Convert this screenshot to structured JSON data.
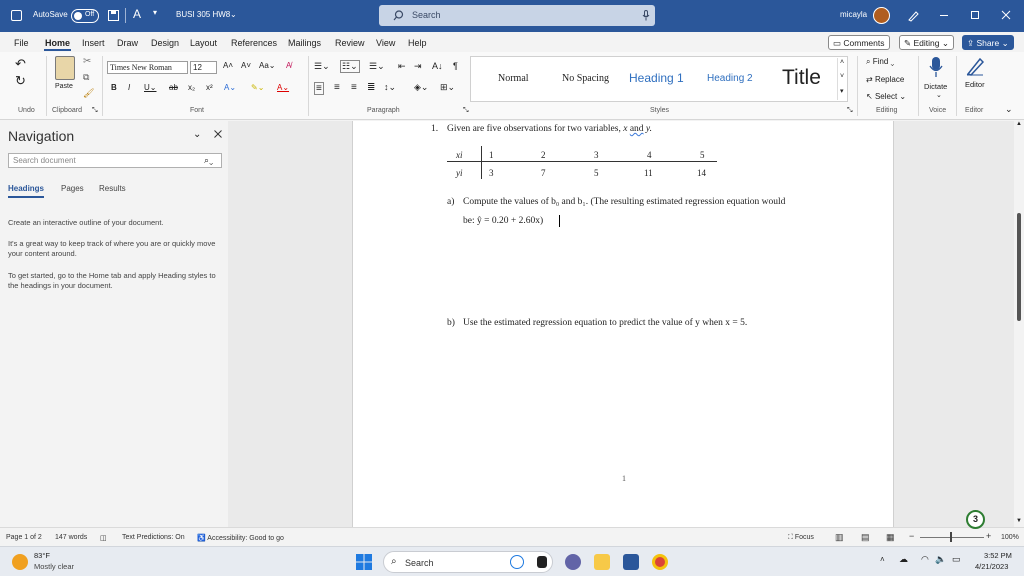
{
  "titlebar": {
    "autosave_label": "AutoSave",
    "autosave_state": "Off",
    "doc_title": "BUSI 305 HW8",
    "search_placeholder": "Search",
    "user_name": "micayla"
  },
  "tabs": [
    "File",
    "Home",
    "Insert",
    "Draw",
    "Design",
    "Layout",
    "References",
    "Mailings",
    "Review",
    "View",
    "Help"
  ],
  "active_tab": "Home",
  "top_buttons": {
    "comments": "Comments",
    "editing": "Editing",
    "share": "Share"
  },
  "ribbon": {
    "undo_label": "Undo",
    "clipboard": {
      "paste": "Paste",
      "label": "Clipboard"
    },
    "font": {
      "name": "Times New Roman",
      "size": "12",
      "label": "Font"
    },
    "paragraph_label": "Paragraph",
    "styles": {
      "items": [
        "Normal",
        "No Spacing",
        "Heading 1",
        "Heading 2",
        "Title"
      ],
      "label": "Styles"
    },
    "editing": {
      "find": "Find",
      "replace": "Replace",
      "select": "Select",
      "label": "Editing"
    },
    "voice": {
      "dictate": "Dictate",
      "label": "Voice"
    },
    "editor": {
      "editor": "Editor",
      "label": "Editor"
    }
  },
  "nav": {
    "title": "Navigation",
    "search_placeholder": "Search document",
    "tabs": [
      "Headings",
      "Pages",
      "Results"
    ],
    "texts": [
      "Create an interactive outline of your document.",
      "It's a great way to keep track of where you are or quickly move your content around.",
      "To get started, go to the Home tab and apply Heading styles to the headings in your document."
    ]
  },
  "doc": {
    "q1_num": "1.",
    "q1_text": "Given are five observations for two variables,",
    "q1_var_x": "x",
    "q1_and": "and",
    "q1_var_y": "y.",
    "table": {
      "row_x_label": "xi",
      "row_y_label": "yi",
      "x": [
        "1",
        "2",
        "3",
        "4",
        "5"
      ],
      "y": [
        "3",
        "7",
        "5",
        "11",
        "14"
      ]
    },
    "part_a_label": "a)",
    "part_a_line1": "Compute the values of b₀ and b₁. (The resulting estimated regression equation would",
    "part_a_line2": "be: ŷ = 0.20 + 2.60x)",
    "part_b_label": "b)",
    "part_b_text": "Use the estimated regression equation to predict the value of y when x = 5.",
    "page_number": "1"
  },
  "status": {
    "page": "Page 1 of 2",
    "words": "147 words",
    "predictions": "Text Predictions: On",
    "accessibility": "Accessibility: Good to go",
    "focus": "Focus",
    "zoom": "100%"
  },
  "taskbar": {
    "weather_temp": "83°F",
    "weather_desc": "Mostly clear",
    "search_placeholder": "Search",
    "time": "3:52 PM",
    "date": "4/21/2023",
    "badge": "3"
  },
  "colors": {
    "word_blue": "#2b579a",
    "heading_blue": "#2f6fbf"
  }
}
